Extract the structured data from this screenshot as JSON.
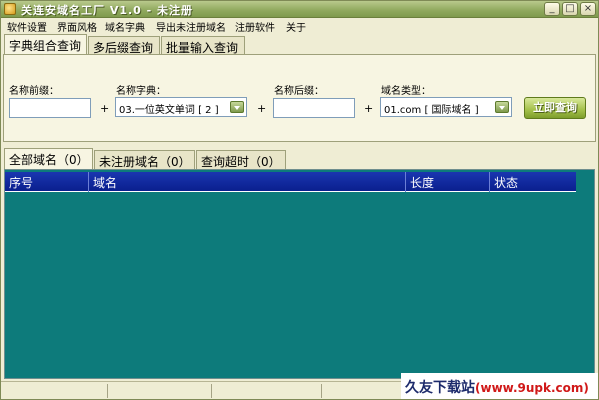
{
  "window": {
    "title": "关连安域名工厂 V1.0 - 未注册"
  },
  "menu": [
    "软件设置",
    "界面风格",
    "域名字典",
    "导出未注册域名",
    "注册软件",
    "关于"
  ],
  "top_tabs": [
    "字典组合查询",
    "多后缀查询",
    "批量输入查询"
  ],
  "form": {
    "prefix_label": "名称前缀：",
    "prefix_value": "",
    "dict_label": "名称字典：",
    "dict_value": "03.一位英文单词 [ 2 ]",
    "suffix_label": "名称后缀：",
    "suffix_value": "",
    "type_label": "域名类型：",
    "type_value": "01.com [ 国际域名 ]",
    "plus": "+",
    "query_button": "立即查询"
  },
  "result_tabs": [
    "全部域名（0）",
    "未注册域名（0）",
    "查询超时（0）"
  ],
  "table": {
    "columns": [
      "序号",
      "域名",
      "长度",
      "状态"
    ],
    "rows": []
  },
  "watermark": {
    "brand": "久友下载站",
    "url": "(www.9upk.com)"
  }
}
